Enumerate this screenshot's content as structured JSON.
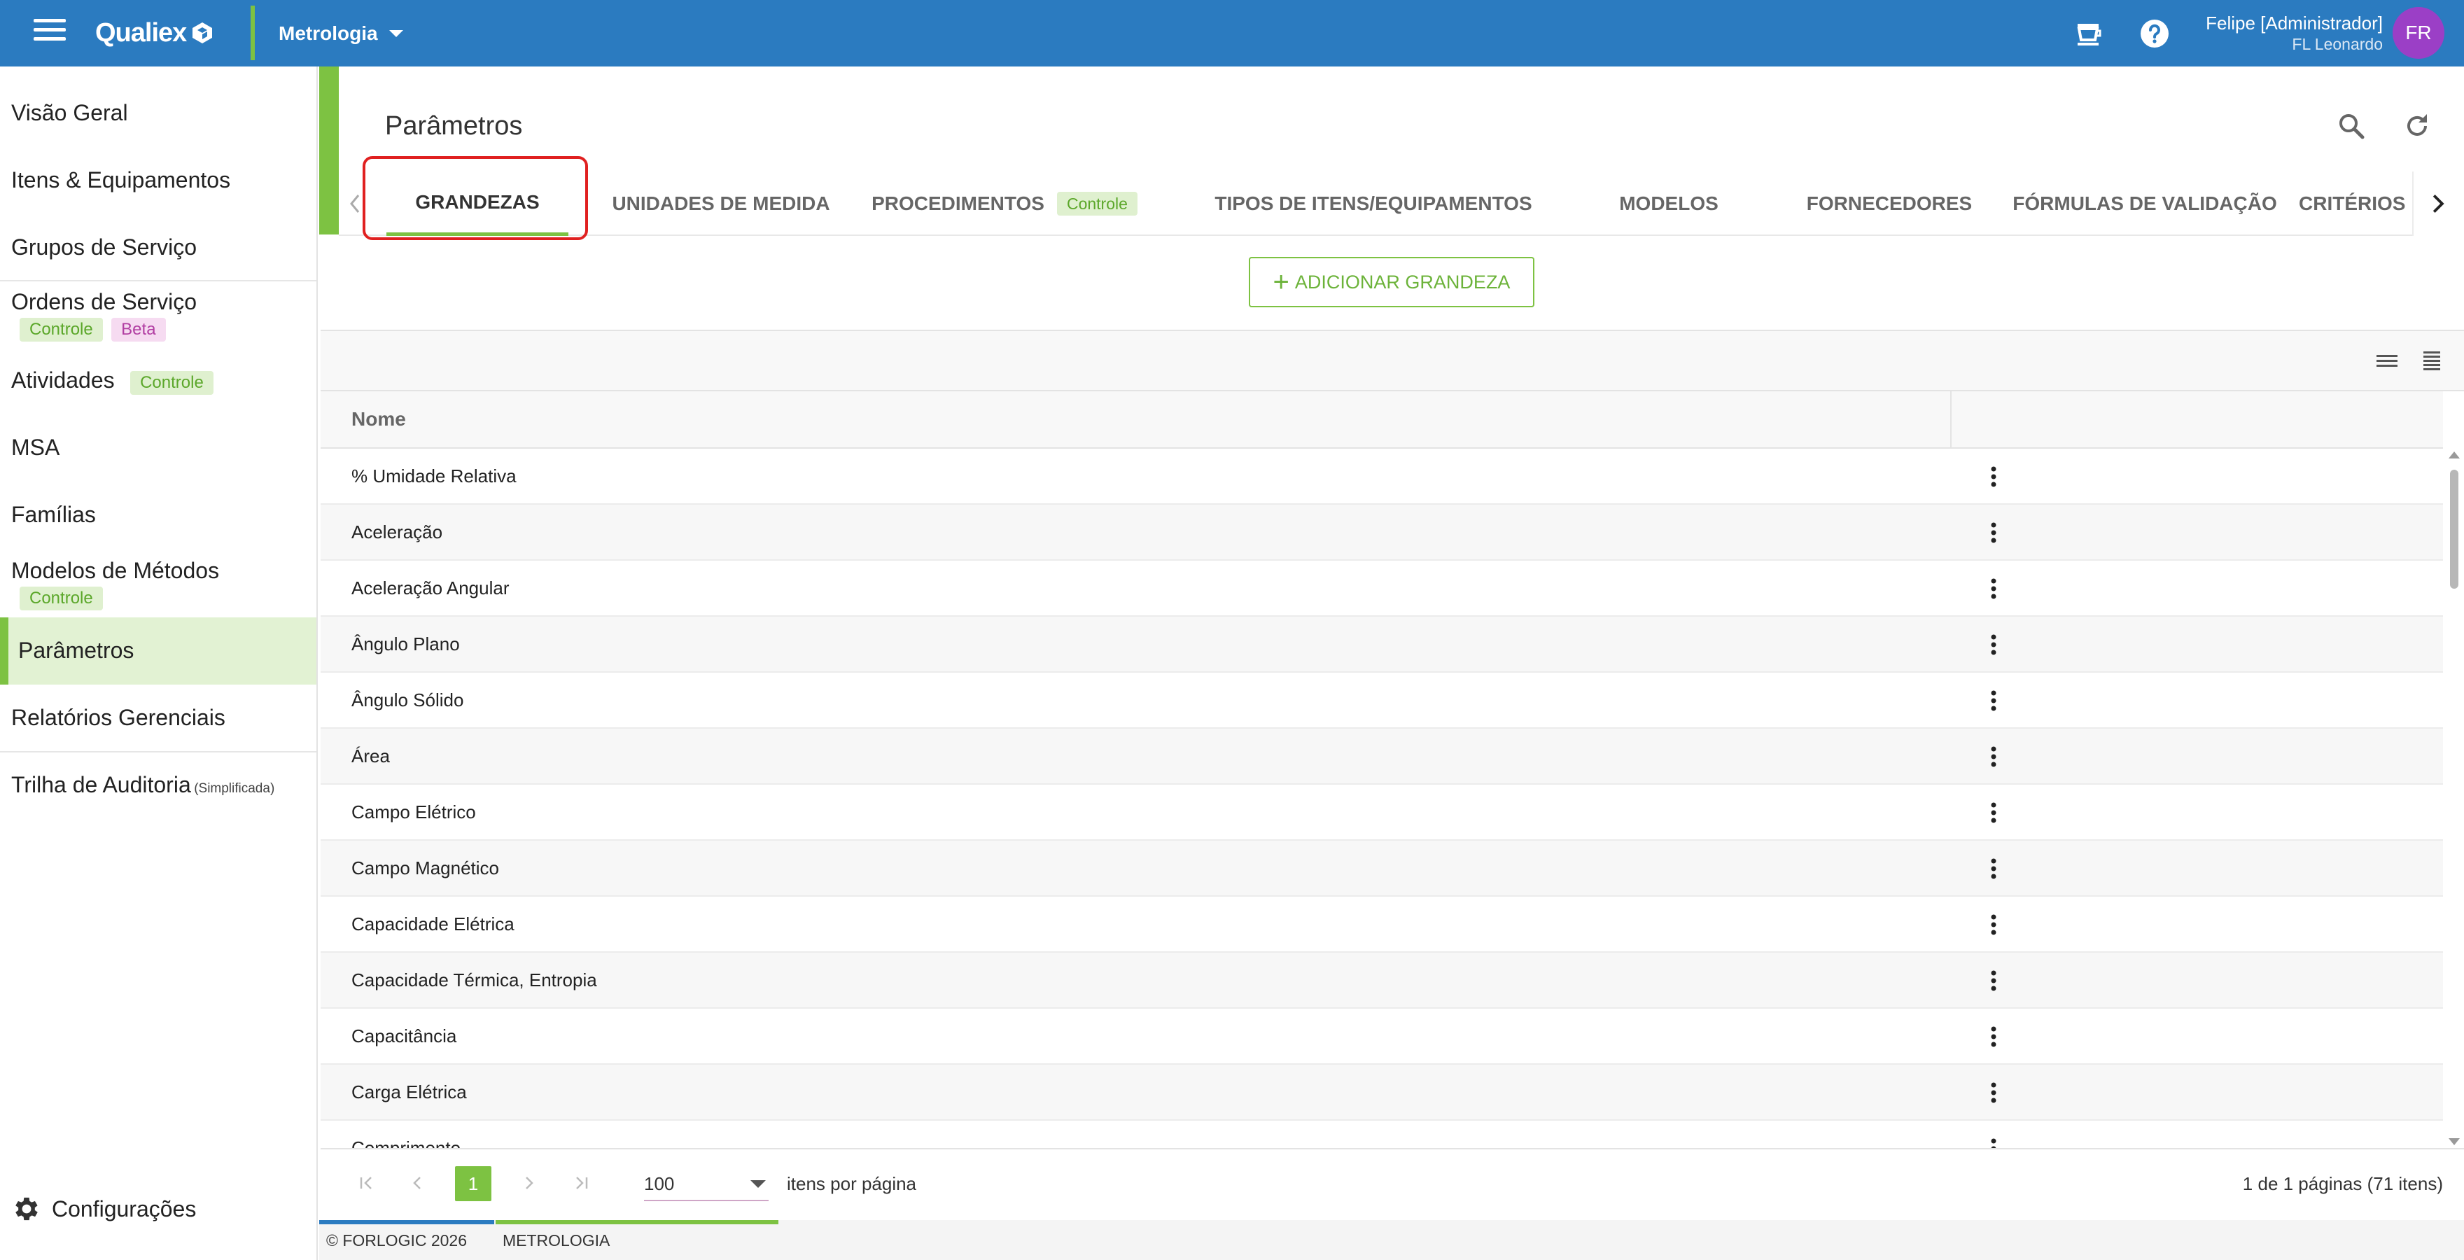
{
  "app": {
    "logo_text": "Qualiex",
    "module": "Metrologia"
  },
  "user": {
    "name": "Felipe [Administrador]",
    "company": "FL Leonardo",
    "initials": "FR"
  },
  "icons": {
    "menu": "hamburger-menu-icon",
    "cup": "coffee-cup-icon",
    "help": "help-circle-icon",
    "search": "search-icon",
    "refresh": "refresh-icon",
    "settings": "gear-icon"
  },
  "colors": {
    "topbar": "#2b7bc0",
    "accent": "#7dc242",
    "avatar": "#9b3fc6",
    "highlight": "#e02020"
  },
  "sidebar": {
    "items": [
      {
        "label": "Visão Geral"
      },
      {
        "label": "Itens & Equipamentos"
      },
      {
        "label": "Grupos de Serviço"
      },
      {
        "label": "Ordens de Serviço",
        "badges": [
          "Controle",
          "Beta"
        ]
      },
      {
        "label": "Atividades",
        "badge": "Controle"
      },
      {
        "label": "MSA"
      },
      {
        "label": "Famílias"
      },
      {
        "label": "Modelos de Métodos",
        "badge": "Controle"
      },
      {
        "label": "Parâmetros",
        "active": true
      },
      {
        "label": "Relatórios Gerenciais"
      },
      {
        "label": "Trilha de Auditoria",
        "suffix": "(Simplificada)"
      }
    ],
    "settings_label": "Configurações"
  },
  "page": {
    "title": "Parâmetros"
  },
  "tabs": [
    {
      "label": "GRANDEZAS",
      "active": true
    },
    {
      "label": "UNIDADES DE MEDIDA"
    },
    {
      "label": "PROCEDIMENTOS",
      "badge": "Controle"
    },
    {
      "label": "TIPOS DE ITENS/EQUIPAMENTOS"
    },
    {
      "label": "MODELOS"
    },
    {
      "label": "FORNECEDORES"
    },
    {
      "label": "FÓRMULAS DE VALIDAÇÃO"
    },
    {
      "label": "CRITÉRIOS D"
    }
  ],
  "actions": {
    "add_label": "ADICIONAR GRANDEZA"
  },
  "grid": {
    "column_name": "Nome",
    "rows": [
      "% Umidade Relativa",
      "Aceleração",
      "Aceleração Angular",
      "Ângulo Plano",
      "Ângulo Sólido",
      "Área",
      "Campo Elétrico",
      "Campo Magnético",
      "Capacidade Elétrica",
      "Capacidade Térmica, Entropia",
      "Capacitância",
      "Carga Elétrica",
      "Comprimento"
    ]
  },
  "pager": {
    "current_page": "1",
    "page_size": "100",
    "per_page_label": "itens por página",
    "summary": "1 de 1 páginas (71 itens)"
  },
  "footer": {
    "copyright": "© FORLOGIC 2026",
    "module": "METROLOGIA"
  }
}
